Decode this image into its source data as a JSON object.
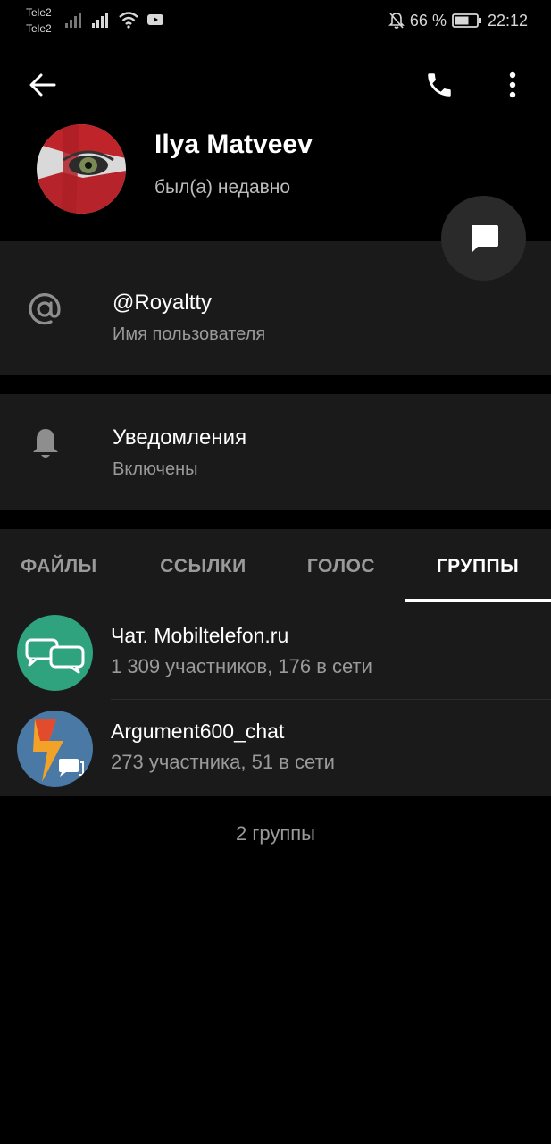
{
  "status_bar": {
    "carrier_1": "Tele2",
    "carrier_2": "Tele2",
    "battery_percent": "66 %",
    "time": "22:12",
    "icons": [
      "signal-icon",
      "signal-icon",
      "wifi-icon",
      "youtube-icon",
      "bell-off-icon",
      "battery-icon"
    ]
  },
  "header": {
    "back_icon": "arrow-left-icon",
    "call_icon": "phone-icon",
    "menu_icon": "more-vertical-icon"
  },
  "profile": {
    "name": "Ilya Matveev",
    "status": "был(а) недавно"
  },
  "fab": {
    "icon": "message-icon"
  },
  "info": {
    "username": {
      "value": "@Royaltty",
      "label": "Имя пользователя",
      "icon": "at-icon"
    },
    "notifications": {
      "value": "Уведомления",
      "label": "Включены",
      "icon": "bell-icon"
    }
  },
  "tabs": [
    {
      "label": "ФАЙЛЫ",
      "active": false
    },
    {
      "label": "ССЫЛКИ",
      "active": false
    },
    {
      "label": "ГОЛОС",
      "active": false
    },
    {
      "label": "ГРУППЫ",
      "active": true
    }
  ],
  "groups": [
    {
      "name": "Чат. Mobiltelefon.ru",
      "meta": "1 309 участников, 176 в сети",
      "avatar_color": "#2fa37d"
    },
    {
      "name": "Argument600_chat",
      "meta": "273 участника, 51 в сети",
      "avatar_color": "#4a79a6"
    }
  ],
  "footer": {
    "count": "2 группы"
  },
  "colors": {
    "background": "#000000",
    "surface": "#1a1a1a",
    "primary_text": "#ffffff",
    "secondary_text": "#9a9a9a"
  }
}
